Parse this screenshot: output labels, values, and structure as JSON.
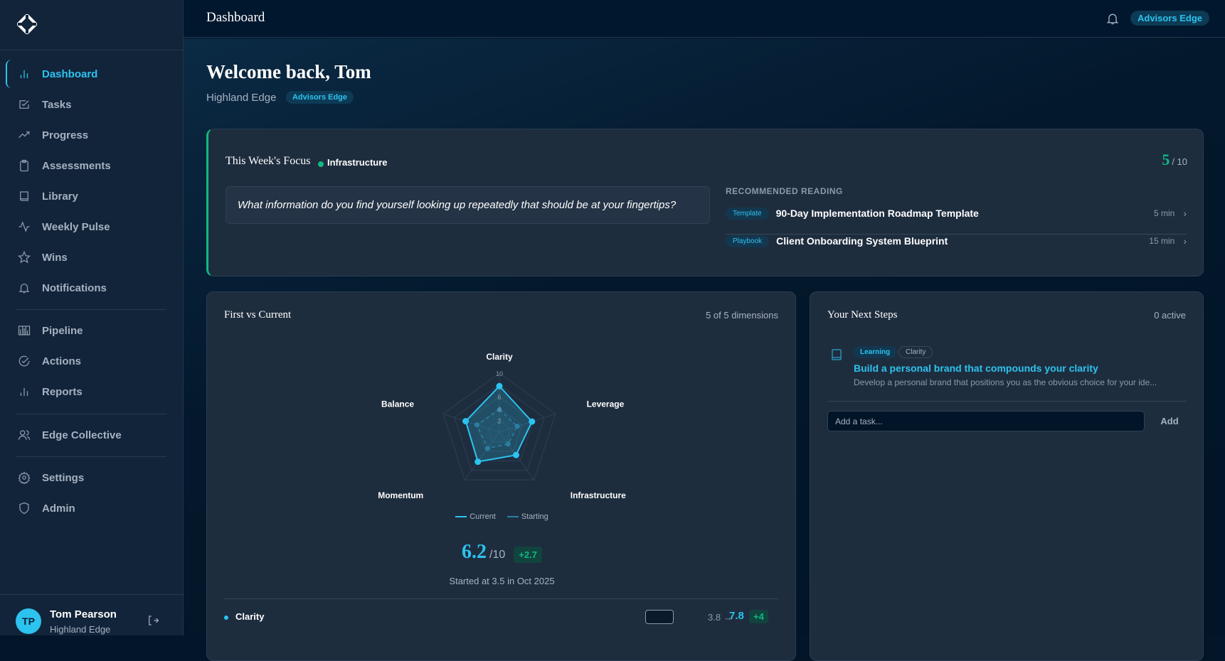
{
  "sidebar": {
    "items": [
      {
        "label": "Dashboard",
        "icon": "bar-chart-icon"
      },
      {
        "label": "Tasks",
        "icon": "checkbox-icon"
      },
      {
        "label": "Progress",
        "icon": "trending-up-icon"
      },
      {
        "label": "Assessments",
        "icon": "clipboard-icon"
      },
      {
        "label": "Library",
        "icon": "book-icon"
      },
      {
        "label": "Weekly Pulse",
        "icon": "activity-icon"
      },
      {
        "label": "Wins",
        "icon": "star-icon"
      },
      {
        "label": "Notifications",
        "icon": "bell-icon"
      },
      {
        "label": "Pipeline",
        "icon": "columns-icon"
      },
      {
        "label": "Actions",
        "icon": "check-circle-icon"
      },
      {
        "label": "Reports",
        "icon": "bar-chart-icon"
      },
      {
        "label": "Edge Collective",
        "icon": "users-icon"
      },
      {
        "label": "Settings",
        "icon": "gear-icon"
      },
      {
        "label": "Admin",
        "icon": "shield-icon"
      }
    ],
    "user": {
      "initials": "TP",
      "name": "Tom Pearson",
      "org": "Highland Edge"
    }
  },
  "header": {
    "title": "Dashboard",
    "badge": "Advisors Edge"
  },
  "welcome": {
    "title": "Welcome back, Tom",
    "org": "Highland Edge",
    "badge": "Advisors Edge"
  },
  "focus": {
    "title": "This Week's Focus",
    "category": "Infrastructure",
    "score": "5",
    "score_max": "/ 10",
    "question": "What information do you find yourself looking up repeatedly that should be at your fingertips?",
    "reading_label": "RECOMMENDED READING",
    "reading": [
      {
        "tag": "Template",
        "title": "90-Day Implementation Roadmap Template",
        "time": "5 min"
      },
      {
        "tag": "Playbook",
        "title": "Client Onboarding System Blueprint",
        "time": "15 min"
      }
    ]
  },
  "radar_card": {
    "title": "First vs Current",
    "dimensions": "5 of 5 dimensions",
    "score": "6.2",
    "score_max": "/10",
    "delta": "+2.7",
    "started": "Started at 3.5 in Oct 2025",
    "row": {
      "name": "Clarity",
      "from": "3.8",
      "arrow": "→",
      "to": "7.8",
      "delta": "+4"
    }
  },
  "chart_data": {
    "type": "radar",
    "axes": [
      "Clarity",
      "Leverage",
      "Infrastructure",
      "Momentum",
      "Balance"
    ],
    "range": [
      0,
      10
    ],
    "ticks": [
      "2",
      "4",
      "6",
      "10"
    ],
    "series": [
      {
        "name": "Current",
        "values": [
          7.8,
          5.8,
          4.8,
          6.2,
          6.0
        ],
        "color": "#2cc3ef"
      },
      {
        "name": "Starting",
        "values": [
          3.8,
          3.2,
          2.5,
          3.4,
          4.0
        ],
        "color": "#2a7fa3"
      }
    ]
  },
  "steps": {
    "title": "Your Next Steps",
    "active": "0 active",
    "item": {
      "tags": [
        "Learning",
        "Clarity"
      ],
      "title": "Build a personal brand that compounds your clarity",
      "desc": "Develop a personal brand that positions you as the obvious choice for your ide..."
    },
    "input_placeholder": "Add a task...",
    "add_label": "Add"
  }
}
